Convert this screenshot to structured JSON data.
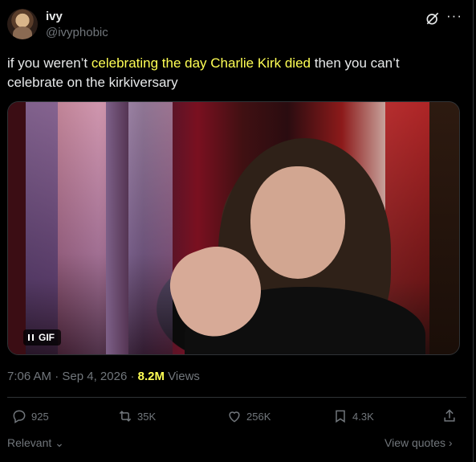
{
  "author": {
    "name": "ivy",
    "handle": "@ivyphobic"
  },
  "tweet": {
    "text_before": "if you weren’t ",
    "text_highlight": "celebrating the day Charlie Kirk died",
    "text_after": " then you can’t celebrate on the kirkiversary"
  },
  "media": {
    "badge_label": "GIF",
    "icon": "pause-icon"
  },
  "meta": {
    "time": "7:06 AM",
    "date": "Sep 4, 2026",
    "separator": "·",
    "views_count": "8.2M",
    "views_label": "Views"
  },
  "actions": {
    "replies": "925",
    "retweets": "35K",
    "likes": "256K",
    "bookmarks": "4.3K"
  },
  "footer": {
    "sort_label": "Relevant",
    "view_quotes_label": "View quotes"
  },
  "colors": {
    "highlight": "#ffff54",
    "muted": "#71767b",
    "like": "#f91880"
  }
}
